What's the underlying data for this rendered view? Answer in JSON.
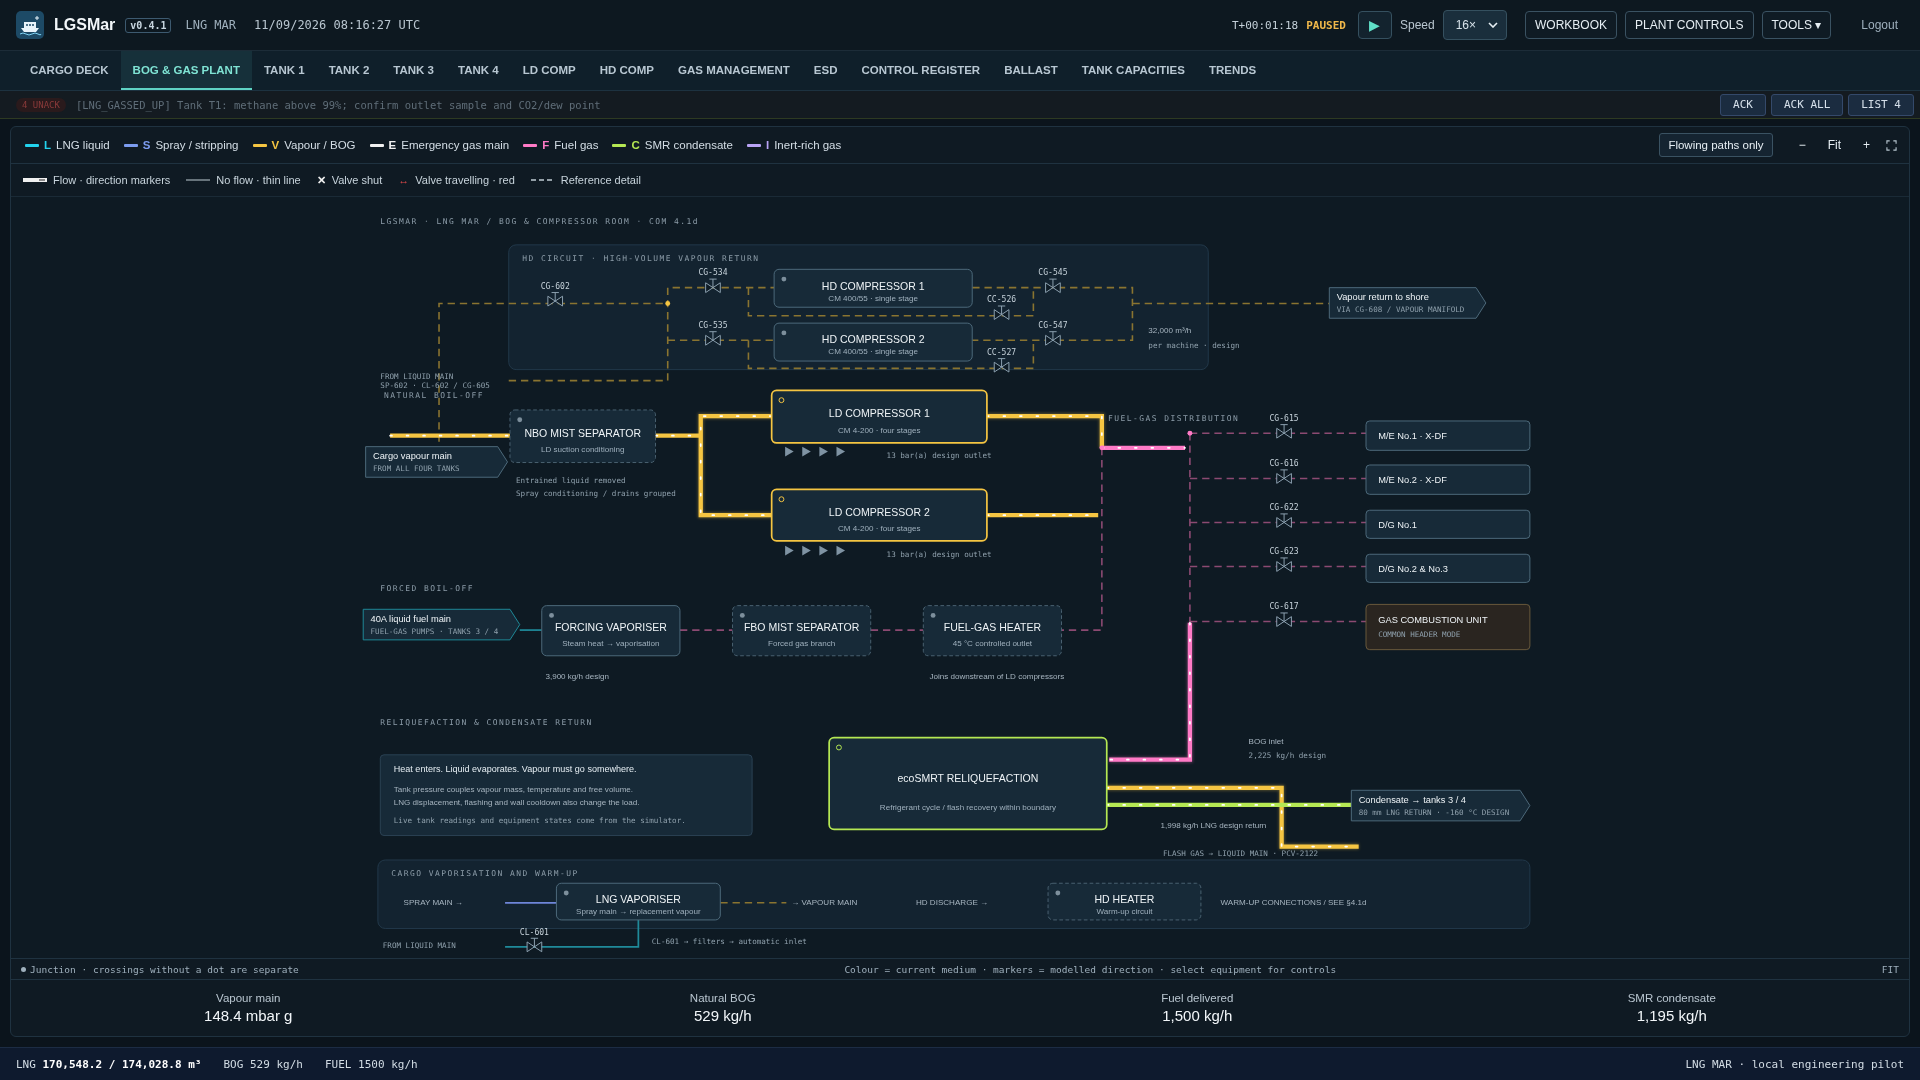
{
  "app": {
    "name": "LGSMar",
    "version": "v0.4.1",
    "vessel": "LNG MAR",
    "datetime": "11/09/2026 08:16:27 UTC"
  },
  "sim": {
    "elapsed": "T+00:01:18",
    "state": "PAUSED",
    "play": "▶",
    "speed_label": "Speed",
    "speed": "16×"
  },
  "header_buttons": [
    "WORKBOOK",
    "PLANT CONTROLS",
    "TOOLS ▾"
  ],
  "logout": "Logout",
  "tabs": [
    {
      "label": "CARGO DECK",
      "selected": false
    },
    {
      "label": "BOG & GAS PLANT",
      "selected": true
    },
    {
      "label": "TANK 1",
      "selected": false
    },
    {
      "label": "TANK 2",
      "selected": false
    },
    {
      "label": "TANK 3",
      "selected": false
    },
    {
      "label": "TANK 4",
      "selected": false
    },
    {
      "label": "LD COMP",
      "selected": false
    },
    {
      "label": "HD COMP",
      "selected": false
    },
    {
      "label": "GAS MANAGEMENT",
      "selected": false
    },
    {
      "label": "ESD",
      "selected": false
    },
    {
      "label": "CONTROL REGISTER",
      "selected": false
    },
    {
      "label": "BALLAST",
      "selected": false
    },
    {
      "label": "TANK CAPACITIES",
      "selected": false
    },
    {
      "label": "TRENDS",
      "selected": false
    }
  ],
  "alarm": {
    "badge": "4 UNACK",
    "message": "[LNG_GASSED_UP] Tank T1: methane above 99%; confirm outlet sample and CO2/dew point",
    "buttons": [
      "ACK",
      "ACK ALL",
      "LIST 4"
    ]
  },
  "legend": [
    {
      "letter": "L",
      "label": "LNG liquid",
      "color": "#22d3ee"
    },
    {
      "letter": "S",
      "label": "Spray / stripping",
      "color": "#7c9cf0"
    },
    {
      "letter": "V",
      "label": "Vapour / BOG",
      "color": "#f5c542"
    },
    {
      "letter": "E",
      "label": "Emergency gas main",
      "color": "#f0f0f0"
    },
    {
      "letter": "F",
      "label": "Fuel gas",
      "color": "#ff7ac6"
    },
    {
      "letter": "C",
      "label": "SMR condensate",
      "color": "#b5e853"
    },
    {
      "letter": "I",
      "label": "Inert-rich gas",
      "color": "#b9a3f5"
    }
  ],
  "legend_keys": [
    {
      "kind": "flow",
      "label": "Flow · direction markers"
    },
    {
      "kind": "thin",
      "label": "No flow · thin line"
    },
    {
      "kind": "shut",
      "symbol": "✕",
      "label": "Valve shut"
    },
    {
      "kind": "travel",
      "symbol": "↔",
      "label": "Valve travelling · red"
    },
    {
      "kind": "reference",
      "label": "Reference detail"
    }
  ],
  "view_controls": {
    "filter": "Flowing paths only",
    "zoom_out": "−",
    "fit": "Fit",
    "zoom_in": "+"
  },
  "diagram": {
    "groups": [
      {
        "title": "HD CIRCUIT · HIGH-VOLUME VAPOUR RETURN"
      },
      {
        "title": "CARGO VAPORISATION AND WARM-UP"
      }
    ],
    "nodes": [
      {
        "kind": "equipment",
        "title": "HD COMPRESSOR 1",
        "subtitle": "CM 400/55 · single stage",
        "running": false,
        "standby": false,
        "highlighted": false
      },
      {
        "kind": "equipment",
        "title": "HD COMPRESSOR 2",
        "subtitle": "CM 400/55 · single stage",
        "running": false,
        "standby": false,
        "highlighted": false
      },
      {
        "kind": "terminal",
        "title": "Vapour return to shore",
        "subtitle": "VIA CG-608 / VAPOUR MANIFOLD",
        "running": false,
        "standby": false,
        "highlighted": false
      },
      {
        "kind": "terminal",
        "title": "Cargo vapour main",
        "subtitle": "FROM ALL FOUR TANKS",
        "running": false,
        "standby": false,
        "highlighted": false
      },
      {
        "kind": "equipment",
        "title": "NBO MIST SEPARATOR",
        "subtitle": "LD suction conditioning",
        "running": false,
        "standby": true,
        "highlighted": false
      },
      {
        "kind": "equipment",
        "title": "LD COMPRESSOR 1",
        "subtitle": "CM 4-200 · four stages",
        "running": true,
        "standby": false,
        "highlighted": false,
        "color": "#f5c542"
      },
      {
        "kind": "equipment",
        "title": "LD COMPRESSOR 2",
        "subtitle": "CM 4-200 · four stages",
        "running": true,
        "standby": false,
        "highlighted": false,
        "color": "#f5c542"
      },
      {
        "kind": "consumer",
        "title": "M/E No.1 · X-DF",
        "running": false,
        "standby": false,
        "highlighted": false
      },
      {
        "kind": "consumer",
        "title": "M/E No.2 · X-DF",
        "running": false,
        "standby": false,
        "highlighted": false
      },
      {
        "kind": "consumer",
        "title": "D/G No.1",
        "running": false,
        "standby": false,
        "highlighted": false
      },
      {
        "kind": "consumer",
        "title": "D/G No.2 & No.3",
        "running": false,
        "standby": false,
        "highlighted": false
      },
      {
        "kind": "terminal",
        "title": "40A liquid fuel main",
        "subtitle": "FUEL-GAS PUMPS · TANKS 3 / 4",
        "running": true,
        "standby": false,
        "highlighted": false,
        "color": "#1f8a9a"
      },
      {
        "kind": "equipment",
        "title": "FORCING VAPORISER",
        "subtitle": "Steam heat → vaporisation",
        "running": false,
        "standby": false,
        "highlighted": false
      },
      {
        "kind": "equipment",
        "title": "FBO MIST SEPARATOR",
        "subtitle": "Forced gas branch",
        "running": false,
        "standby": true,
        "highlighted": false
      },
      {
        "kind": "equipment",
        "title": "FUEL-GAS HEATER",
        "subtitle": "45 °C controlled outlet",
        "running": false,
        "standby": true,
        "highlighted": false
      },
      {
        "kind": "consumer",
        "title": "GAS COMBUSTION UNIT",
        "subtitle": "COMMON HEADER MODE",
        "running": false,
        "standby": false,
        "highlighted": true
      },
      {
        "kind": "equipment",
        "title": "ecoSMRT RELIQUEFACTION",
        "subtitle": "Refrigerant cycle / flash recovery within boundary",
        "running": true,
        "standby": false,
        "highlighted": false,
        "color": "#b5e853"
      },
      {
        "kind": "terminal",
        "title": "Condensate → tanks 3 / 4",
        "subtitle": "80 mm LNG RETURN · -160 °C DESIGN",
        "running": false,
        "standby": false,
        "highlighted": false
      },
      {
        "kind": "equipment",
        "title": "LNG VAPORISER",
        "subtitle": "Spray main → replacement vapour",
        "running": false,
        "standby": false,
        "highlighted": false
      },
      {
        "kind": "equipment",
        "title": "HD HEATER",
        "subtitle": "Warm-up circuit",
        "running": false,
        "standby": true,
        "highlighted": false
      }
    ],
    "valves": [
      "CG-602",
      "CG-534",
      "CG-535",
      "CC-526",
      "CG-545",
      "CC-527",
      "CG-547",
      "CG-615",
      "CG-616",
      "CG-622",
      "CG-623",
      "CG-617",
      "CL-601"
    ],
    "labels": [
      {
        "kind": "section",
        "text": "LGSMAR · LNG MAR / BOG & COMPRESSOR ROOM · COM 4.1d"
      },
      {
        "kind": "note",
        "text": "32,000 m³/h"
      },
      {
        "kind": "mono",
        "text": "per machine · design"
      },
      {
        "kind": "mono",
        "text": "FROM LIQUID MAIN"
      },
      {
        "kind": "mono",
        "text": "SP-602 · CL-602 / CG-605"
      },
      {
        "kind": "section",
        "text": "NATURAL BOIL-OFF"
      },
      {
        "kind": "mono",
        "text": "Entrained liquid removed"
      },
      {
        "kind": "mono",
        "text": "Spray conditioning / drains grouped"
      },
      {
        "kind": "mono",
        "text": "13 bar(a) design outlet"
      },
      {
        "kind": "mono",
        "text": "13 bar(a) design outlet"
      },
      {
        "kind": "section",
        "text": "FUEL-GAS DISTRIBUTION"
      },
      {
        "kind": "section",
        "text": "FORCED BOIL-OFF"
      },
      {
        "kind": "note",
        "text": "3,900 kg/h design"
      },
      {
        "kind": "note",
        "text": "Joins downstream of LD compressors"
      },
      {
        "kind": "section",
        "text": "RELIQUEFACTION & CONDENSATE RETURN"
      },
      {
        "kind": "note",
        "text": "BOG inlet"
      },
      {
        "kind": "mono",
        "text": "2,225 kg/h design"
      },
      {
        "kind": "note",
        "text": "1,998 kg/h LNG design return"
      },
      {
        "kind": "mono",
        "text": "FLASH GAS → LIQUID MAIN · PCV-2122"
      },
      {
        "kind": "note",
        "text": "SPRAY MAIN →"
      },
      {
        "kind": "note",
        "text": "→ VAPOUR MAIN"
      },
      {
        "kind": "note",
        "text": "HD DISCHARGE →"
      },
      {
        "kind": "note",
        "text": "WARM-UP CONNECTIONS / SEE §4.1d"
      },
      {
        "kind": "mono",
        "text": "FROM LIQUID MAIN"
      },
      {
        "kind": "mono",
        "text": "CL-601 → filters → automatic inlet"
      }
    ],
    "info_card": {
      "heading": "Heat enters. Liquid evaporates. Vapour must go somewhere.",
      "lines": [
        "Tank pressure couples vapour mass, temperature and free volume.",
        "LNG displacement, flashing and wall cooldown also change the load."
      ],
      "footnote": "Live tank readings and equipment states come from the simulator."
    }
  },
  "footer": {
    "junction": "Junction · crossings without a dot are separate",
    "hint": "Colour = current medium · markers = modelled direction · select equipment for controls",
    "fit": "FIT"
  },
  "stats": [
    {
      "label": "Vapour main",
      "value": "148.4 mbar g"
    },
    {
      "label": "Natural BOG",
      "value": "529 kg/h"
    },
    {
      "label": "Fuel delivered",
      "value": "1,500 kg/h"
    },
    {
      "label": "SMR condensate",
      "value": "1,195 kg/h"
    }
  ],
  "status_bar": {
    "lng": "LNG **170,548.2 / 174,028.8 m³**",
    "bog": "BOG 529 kg/h",
    "fuel": "FUEL 1500 kg/h",
    "right": "LNG MAR · local engineering pilot"
  }
}
